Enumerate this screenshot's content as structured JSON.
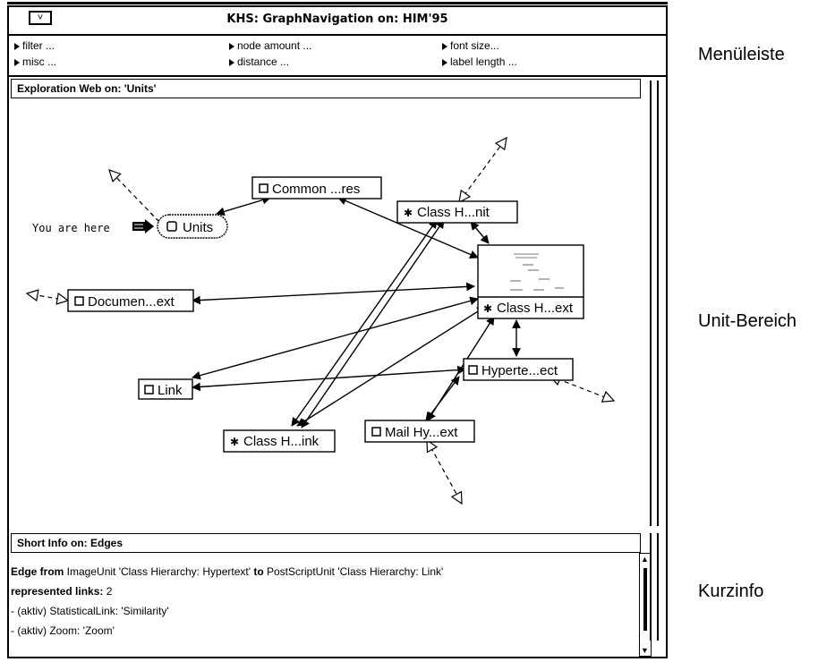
{
  "window": {
    "title": "KHS: GraphNavigation on: HIM'95",
    "system_button": "˅"
  },
  "menu": {
    "items": [
      {
        "label": "filter ..."
      },
      {
        "label": "node amount ..."
      },
      {
        "label": "font size..."
      },
      {
        "label": "misc ..."
      },
      {
        "label": "distance ..."
      },
      {
        "label": "label length ..."
      }
    ]
  },
  "exploration": {
    "header": "Exploration Web on: 'Units'",
    "you_are_here": "You are here",
    "nodes": [
      {
        "id": "units",
        "label": "Units",
        "icon": "document-icon"
      },
      {
        "id": "common",
        "label": "Common ...res",
        "icon": "document-icon"
      },
      {
        "id": "classhnit",
        "label": "Class H...nit",
        "icon": "star-icon"
      },
      {
        "id": "documen",
        "label": "Documen...ext",
        "icon": "document-icon"
      },
      {
        "id": "classhext",
        "label": "Class H...ext",
        "icon": "star-icon"
      },
      {
        "id": "link",
        "label": "Link",
        "icon": "document-icon"
      },
      {
        "id": "hyperte",
        "label": "Hyperte...ect",
        "icon": "document-icon"
      },
      {
        "id": "classhink",
        "label": "Class H...ink",
        "icon": "star-icon"
      },
      {
        "id": "mailhy",
        "label": "Mail Hy...ext",
        "icon": "document-icon"
      }
    ]
  },
  "info": {
    "header": "Short Info on: Edges",
    "line1": {
      "p1": "Edge from",
      "p2": " ImageUnit 'Class Hierarchy: Hypertext' ",
      "p3": "to",
      "p4": " PostScriptUnit 'Class Hierarchy: Link'"
    },
    "line2": {
      "label": "represented links:",
      "value": " 2"
    },
    "line3": "-  (aktiv) StatisticalLink: 'Similarity'",
    "line4": "-  (aktiv) Zoom: 'Zoom'"
  },
  "annotations": {
    "menu": "Menüleiste",
    "unit": "Unit-Bereich",
    "info": "Kurzinfo"
  }
}
